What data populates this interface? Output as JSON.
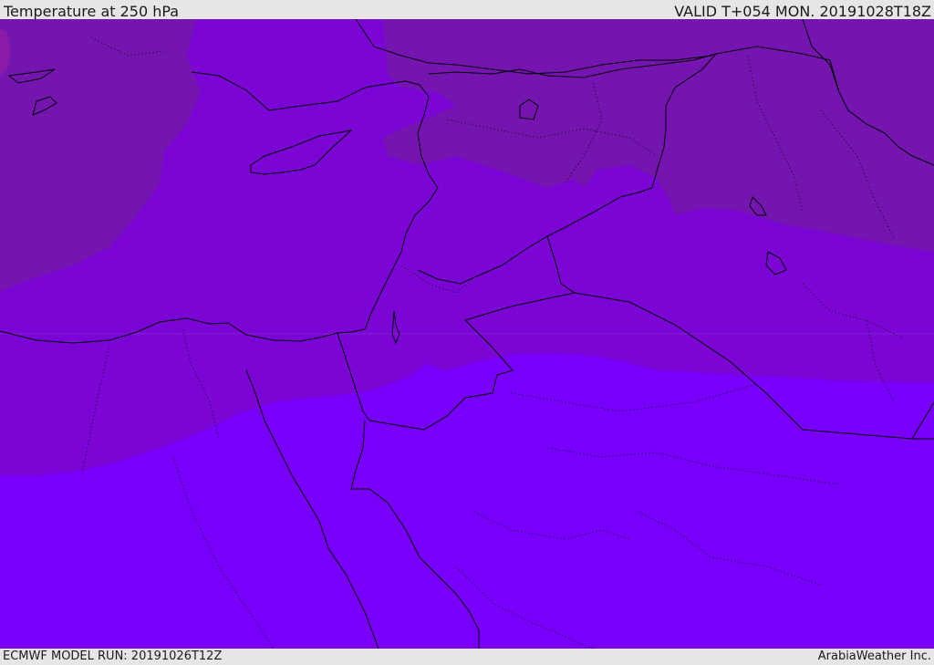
{
  "header": {
    "title": "Temperature at 250 hPa",
    "valid_time": "VALID T+054 MON. 20191028T18Z"
  },
  "footer": {
    "model_run": "ECMWF MODEL RUN: 20191026T12Z",
    "credit": "ArabiaWeather Inc."
  },
  "colors": {
    "band_coldest": "#7415b0",
    "band_cold": "#7a05d4",
    "band_warm": "#7800fa",
    "border_line": "#000000",
    "frame_bg": "#e6e6e6"
  }
}
